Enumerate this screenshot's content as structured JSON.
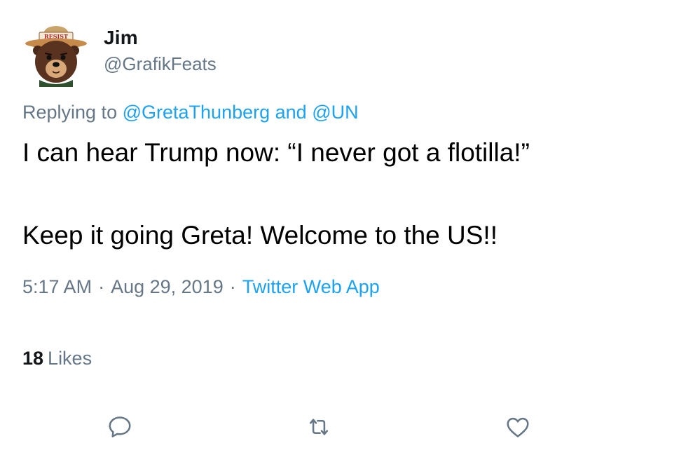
{
  "author": {
    "name": "Jim",
    "handle": "@GrafikFeats",
    "avatar_icon": "smokey-bear-resist-avatar-icon",
    "avatar_hat_text": "RESIST"
  },
  "reply": {
    "prefix": "Replying to",
    "mention1": "@GretaThunberg",
    "connector": "and",
    "mention2": "@UN"
  },
  "tweet": {
    "paragraphs": [
      "I can hear Trump now: “I never got a flotilla!”",
      "Keep it going Greta! Welcome to the US!!"
    ]
  },
  "meta": {
    "time": "5:17 AM",
    "separator": "·",
    "date": "Aug 29, 2019",
    "source": "Twitter Web App"
  },
  "stats": {
    "likes_count": "18",
    "likes_label": "Likes"
  },
  "actions": {
    "reply_icon": "reply-icon",
    "retweet_icon": "retweet-icon",
    "like_icon": "heart-icon"
  },
  "colors": {
    "link": "#1da1f2",
    "muted": "#657786",
    "text": "#000000"
  }
}
